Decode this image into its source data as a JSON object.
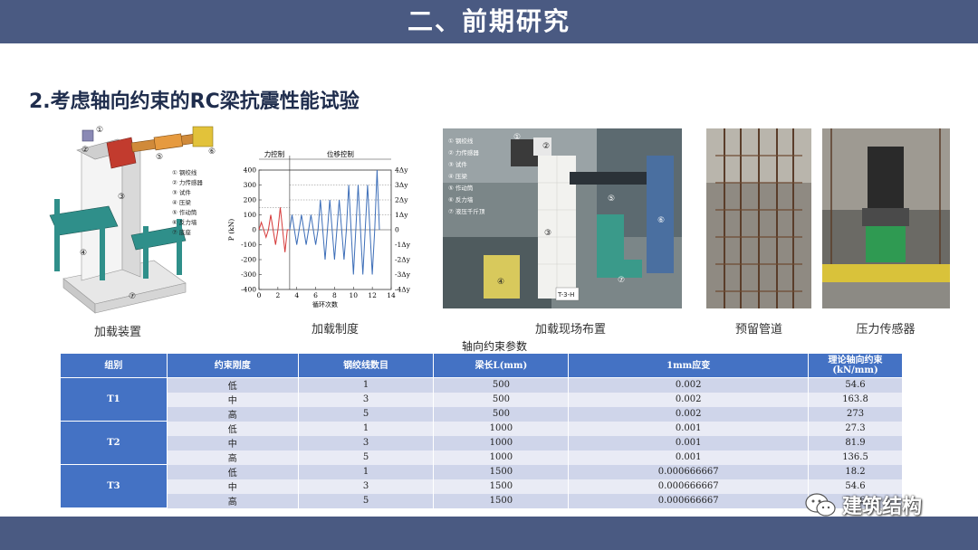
{
  "header": {
    "title": "二、前期研究"
  },
  "section": {
    "subtitle": "2.考虑轴向约束的RC梁抗震性能试验"
  },
  "figures": {
    "loading_device": {
      "caption": "加载装置",
      "legend": [
        "① 钢绞线",
        "② 力传感器",
        "③ 试件",
        "④ 压梁",
        "⑤ 作动筒",
        "⑥ 反力墙",
        "⑦ 底座"
      ],
      "markers": [
        "①",
        "②",
        "③",
        "④",
        "⑤",
        "⑥",
        "⑦"
      ]
    },
    "loading_scheme": {
      "caption": "加载制度",
      "region_force": "力控制",
      "region_disp": "位移控制",
      "ylabel": "P (kN)",
      "xlabel": "循环次数",
      "yticks": [
        "400",
        "300",
        "200",
        "100",
        "0",
        "-100",
        "-200",
        "-300",
        "-400"
      ],
      "xticks": [
        "0",
        "2",
        "4",
        "6",
        "8",
        "10",
        "12",
        "14"
      ],
      "right_ticks": [
        "4Δy",
        "3Δy",
        "2Δy",
        "1Δy",
        "0",
        "-1Δy",
        "-2Δy",
        "-3Δy",
        "-4Δy"
      ]
    },
    "site_layout": {
      "caption": "加载现场布置",
      "legend": [
        "① 钢绞线",
        "② 力传感器",
        "③ 试件",
        "④ 压梁",
        "⑤ 作动筒",
        "⑥ 反力墙",
        "⑦ 液压千斤顶"
      ],
      "specimen_tag": "T-3-H"
    },
    "duct": {
      "caption": "预留管道"
    },
    "sensor": {
      "caption": "压力传感器"
    }
  },
  "chart_data": {
    "type": "line",
    "title": "",
    "xlabel": "循环次数",
    "ylabel": "P (kN)",
    "xlim": [
      0,
      14
    ],
    "ylim": [
      -400,
      400
    ],
    "series": [
      {
        "color": "#d63a3a",
        "x": [
          0,
          0.25,
          0.5,
          0.75,
          1.0,
          1.25,
          1.5,
          1.75,
          2.0,
          2.25,
          2.5,
          2.75,
          3.0,
          3.25
        ],
        "y": [
          0,
          50,
          0,
          -50,
          0,
          100,
          0,
          -100,
          0,
          150,
          0,
          -150,
          0,
          0
        ]
      },
      {
        "color": "#3d6eb8",
        "x": [
          3.25,
          3.5,
          3.75,
          4.0,
          4.25,
          4.5,
          4.75,
          5.0,
          5.25,
          5.5,
          5.75,
          6.0,
          6.25,
          6.5,
          6.75,
          7.0,
          7.25,
          7.5,
          7.75,
          8.0,
          8.25,
          8.5,
          8.75,
          9.0,
          9.25,
          9.5,
          9.75,
          10.0,
          10.25,
          10.5,
          10.75,
          11.0,
          11.25,
          11.5,
          11.75,
          12.0,
          12.25,
          12.5,
          12.75
        ],
        "y": [
          0,
          100,
          0,
          -100,
          0,
          100,
          0,
          -100,
          0,
          100,
          0,
          -100,
          0,
          200,
          0,
          -200,
          0,
          200,
          0,
          -200,
          0,
          200,
          0,
          -200,
          0,
          300,
          0,
          -300,
          0,
          300,
          0,
          -300,
          0,
          300,
          0,
          -300,
          0,
          400,
          0
        ]
      }
    ]
  },
  "table": {
    "title": "轴向约束参数",
    "headers": [
      "组别",
      "约束刚度",
      "钢绞线数目",
      "梁长L(mm)",
      "1mm应变",
      "理论轴向约束 (kN/mm)"
    ],
    "groups": [
      {
        "name": "T1",
        "rows": [
          [
            "低",
            "1",
            "500",
            "0.002",
            "54.6"
          ],
          [
            "中",
            "3",
            "500",
            "0.002",
            "163.8"
          ],
          [
            "高",
            "5",
            "500",
            "0.002",
            "273"
          ]
        ]
      },
      {
        "name": "T2",
        "rows": [
          [
            "低",
            "1",
            "1000",
            "0.001",
            "27.3"
          ],
          [
            "中",
            "3",
            "1000",
            "0.001",
            "81.9"
          ],
          [
            "高",
            "5",
            "1000",
            "0.001",
            "136.5"
          ]
        ]
      },
      {
        "name": "T3",
        "rows": [
          [
            "低",
            "1",
            "1500",
            "0.000666667",
            "18.2"
          ],
          [
            "中",
            "3",
            "1500",
            "0.000666667",
            "54.6"
          ],
          [
            "高",
            "5",
            "1500",
            "0.000666667",
            "54.6"
          ]
        ]
      }
    ]
  },
  "footer": {
    "brand": "建筑结构",
    "icon": "wechat-icon"
  }
}
